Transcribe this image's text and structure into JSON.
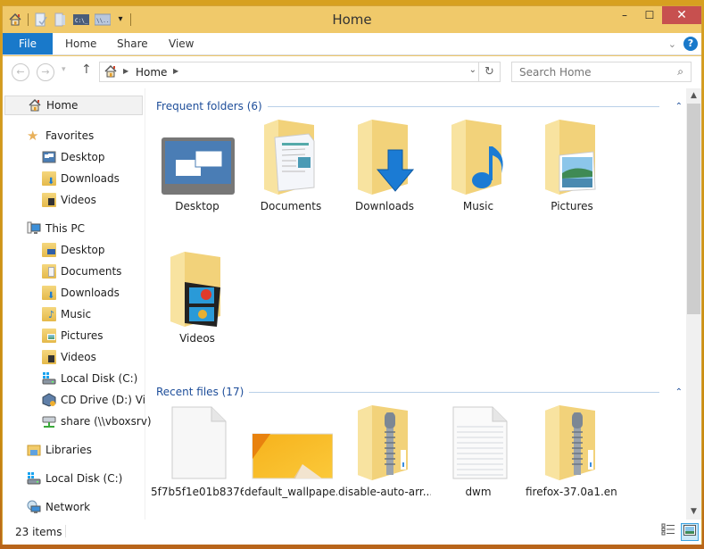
{
  "window": {
    "title": "Home",
    "controls": {
      "minimize": "–",
      "maximize": "☐",
      "close": "✕"
    }
  },
  "quick_access": [
    {
      "icon": "home-icon"
    },
    {
      "icon": "properties-icon"
    },
    {
      "icon": "new-folder-icon"
    },
    {
      "icon": "command-prompt-icon",
      "text": "C:\\_"
    },
    {
      "icon": "powershell-icon",
      "text": "\\\\..."
    },
    {
      "icon": "customize-dropdown-icon",
      "text": "▾"
    }
  ],
  "ribbon": {
    "tabs": [
      {
        "label": "File",
        "active": true
      },
      {
        "label": "Home"
      },
      {
        "label": "Share"
      },
      {
        "label": "View"
      }
    ],
    "expand": "⌄",
    "help": "?"
  },
  "navbar": {
    "back": "←",
    "forward": "→",
    "recent": "▾",
    "up": "↑",
    "breadcrumb": [
      "Home"
    ],
    "dropdown": "⌄",
    "refresh": "↻",
    "search_placeholder": "Search Home",
    "search_icon": "⌕"
  },
  "sidebar": {
    "items": [
      {
        "label": "Home",
        "icon": "home-icon",
        "level": 0,
        "selected": true
      },
      {
        "label": "Favorites",
        "icon": "star-icon",
        "level": 0
      },
      {
        "label": "Desktop",
        "icon": "desktop-icon",
        "level": 1
      },
      {
        "label": "Downloads",
        "icon": "downloads-folder-icon",
        "level": 1
      },
      {
        "label": "Videos",
        "icon": "videos-folder-icon",
        "level": 1
      },
      {
        "label": "This PC",
        "icon": "computer-icon",
        "level": 0
      },
      {
        "label": "Desktop",
        "icon": "desktop-folder-icon",
        "level": 1
      },
      {
        "label": "Documents",
        "icon": "documents-folder-icon",
        "level": 1
      },
      {
        "label": "Downloads",
        "icon": "downloads-folder-icon",
        "level": 1
      },
      {
        "label": "Music",
        "icon": "music-folder-icon",
        "level": 1
      },
      {
        "label": "Pictures",
        "icon": "pictures-folder-icon",
        "level": 1
      },
      {
        "label": "Videos",
        "icon": "videos-folder-icon",
        "level": 1
      },
      {
        "label": "Local Disk (C:)",
        "icon": "local-disk-icon",
        "level": 1
      },
      {
        "label": "CD Drive (D:) VirtualBox Guest Additions",
        "icon": "cd-drive-icon",
        "level": 1
      },
      {
        "label": "share (\\\\vboxsrv)",
        "icon": "network-share-icon",
        "level": 1
      },
      {
        "label": "Libraries",
        "icon": "libraries-icon",
        "level": 0
      },
      {
        "label": "Local Disk (C:)",
        "icon": "local-disk-icon",
        "level": 0
      },
      {
        "label": "Network",
        "icon": "network-icon",
        "level": 0
      }
    ]
  },
  "main": {
    "frequent": {
      "title": "Frequent folders (6)",
      "items": [
        {
          "label": "Desktop",
          "icon": "desktop-icon"
        },
        {
          "label": "Documents",
          "icon": "documents-folder-icon"
        },
        {
          "label": "Downloads",
          "icon": "downloads-folder-icon"
        },
        {
          "label": "Music",
          "icon": "music-folder-icon"
        },
        {
          "label": "Pictures",
          "icon": "pictures-folder-icon"
        },
        {
          "label": "Videos",
          "icon": "videos-folder-icon"
        }
      ]
    },
    "recent": {
      "title": "Recent files (17)",
      "items": [
        {
          "label": "5f7b5f1e01b8376...",
          "icon": "blank-file-icon"
        },
        {
          "label": "default_wallpape...",
          "icon": "image-thumbnail-icon"
        },
        {
          "label": "disable-auto-arr...",
          "icon": "zip-folder-icon"
        },
        {
          "label": "dwm",
          "icon": "text-file-icon"
        },
        {
          "label": "firefox-37.0a1.en...",
          "icon": "zip-folder-icon"
        }
      ]
    },
    "collapse": "⌃"
  },
  "status": {
    "item_count": "23 items"
  },
  "colors": {
    "accent": "#1979ca",
    "title_bar": "#f0c96a",
    "close": "#c7504f",
    "group_header": "#1e4e9a"
  }
}
